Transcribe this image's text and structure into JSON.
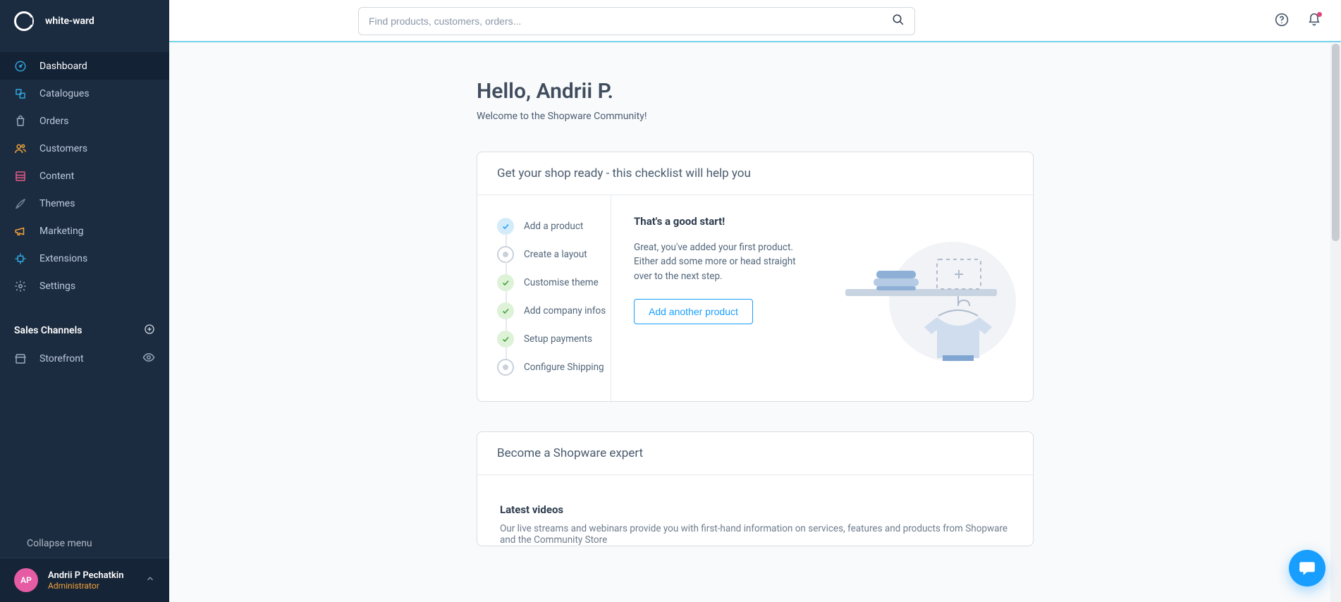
{
  "brand": {
    "name": "white-ward"
  },
  "search": {
    "placeholder": "Find products, customers, orders..."
  },
  "nav": [
    {
      "label": "Dashboard",
      "icon": "gauge",
      "color": "#2fa3d8"
    },
    {
      "label": "Catalogues",
      "icon": "catalog",
      "color": "#2fa3d8"
    },
    {
      "label": "Orders",
      "icon": "bag",
      "color": "#9aa9bc"
    },
    {
      "label": "Customers",
      "icon": "users",
      "color": "#f2a33a"
    },
    {
      "label": "Content",
      "icon": "layout",
      "color": "#e45a86"
    },
    {
      "label": "Themes",
      "icon": "brush",
      "color": "#6f8096"
    },
    {
      "label": "Marketing",
      "icon": "megaphone",
      "color": "#f2a33a"
    },
    {
      "label": "Extensions",
      "icon": "plugin",
      "color": "#2fa3d8"
    },
    {
      "label": "Settings",
      "icon": "gear",
      "color": "#9aa9bc"
    }
  ],
  "salesChannels": {
    "heading": "Sales Channels",
    "item": "Storefront"
  },
  "collapse": {
    "label": "Collapse menu"
  },
  "user": {
    "initials": "AP",
    "name": "Andrii P Pechatkin",
    "role": "Administrator"
  },
  "greeting": {
    "title": "Hello, Andrii P.",
    "subtitle": "Welcome to the Shopware Community!"
  },
  "checklistCard": {
    "title": "Get your shop ready - this checklist will help you",
    "items": [
      {
        "label": "Add a product",
        "state": "blue"
      },
      {
        "label": "Create a layout",
        "state": "grey"
      },
      {
        "label": "Customise theme",
        "state": "green"
      },
      {
        "label": "Add company infos",
        "state": "green"
      },
      {
        "label": "Setup payments",
        "state": "green"
      },
      {
        "label": "Configure Shipping",
        "state": "grey"
      }
    ],
    "detail": {
      "heading": "That's a good start!",
      "body": "Great, you've added your first product. Either add some more or head straight over to the next step.",
      "button": "Add another product"
    }
  },
  "expertCard": {
    "title": "Become a Shopware expert",
    "subHeading": "Latest videos",
    "subBody": "Our live streams and webinars provide you with first-hand information on services, features and products from Shopware and the Community Store"
  }
}
